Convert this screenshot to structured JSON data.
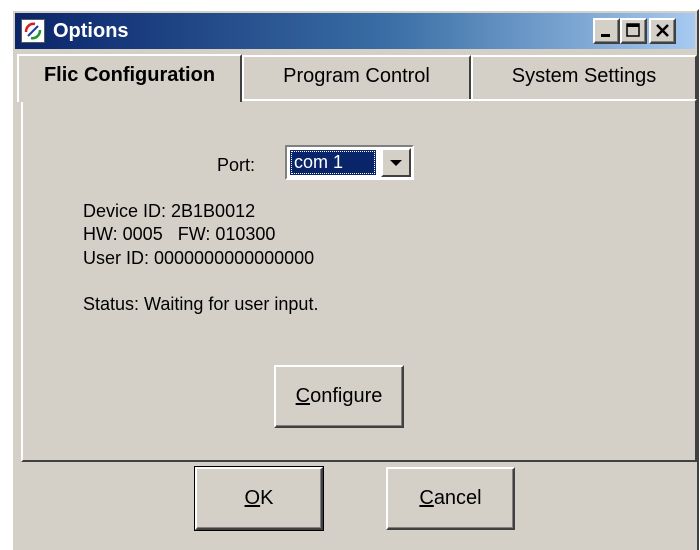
{
  "window": {
    "title": "Options",
    "buttons": {
      "minimize": "minimize",
      "maximize": "maximize",
      "close": "close"
    }
  },
  "tabs": [
    {
      "label": "Flic Configuration",
      "active": true
    },
    {
      "label": "Program Control",
      "active": false
    },
    {
      "label": "System Settings",
      "active": false
    }
  ],
  "config": {
    "port_label": "Port:",
    "port_value": "com 1",
    "device_id": "Device ID: 2B1B0012",
    "hw_fw": "HW: 0005   FW: 010300",
    "user_id": "User ID: 0000000000000000",
    "status": "Status: Waiting for user input.",
    "configure": {
      "mnemonic": "C",
      "rest": "onfigure"
    }
  },
  "footer": {
    "ok": {
      "mnemonic": "O",
      "rest": "K"
    },
    "cancel": {
      "mnemonic": "C",
      "rest": "ancel"
    }
  },
  "colors": {
    "title_gradient_start": "#0a246a",
    "title_gradient_end": "#a6caf0",
    "face": "#d4d0c8",
    "selection": "#0a246a"
  },
  "icons": [
    "app-icon",
    "minimize-icon",
    "maximize-icon",
    "close-icon",
    "dropdown-arrow-icon"
  ]
}
